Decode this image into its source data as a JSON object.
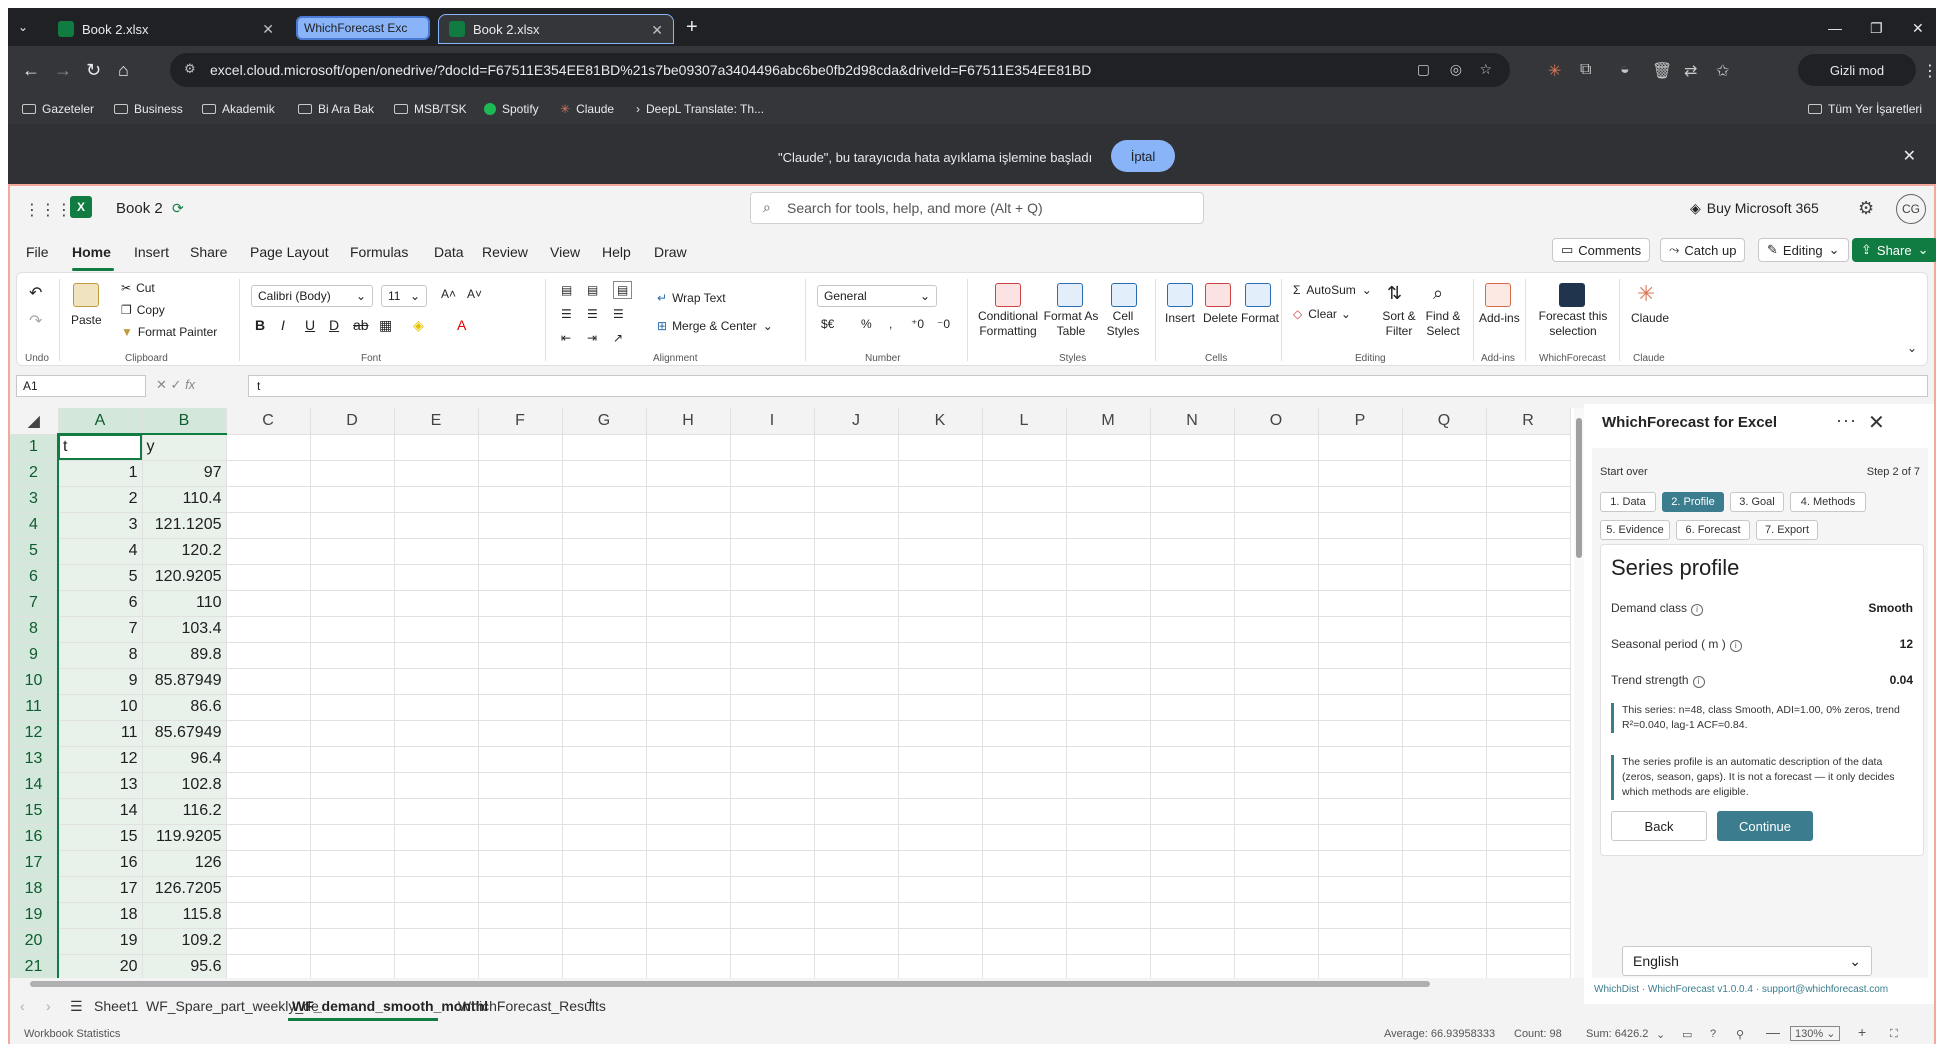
{
  "browser": {
    "tabs": [
      {
        "label": "Book 2.xlsx"
      },
      {
        "label": "WhichForecast Exc"
      },
      {
        "label": "Book 2.xlsx"
      }
    ],
    "url": "excel.cloud.microsoft/open/onedrive/?docId=F67511E354EE81BD%21s7be09307a3404496abc6be0fb2d98cda&driveId=F67511E354EE81BD",
    "incognito_label": "Gizli mod",
    "bookmarks": [
      "Gazeteler",
      "Business",
      "Akademik",
      "Bi Ara Bak",
      "MSB/TSK",
      "Spotify",
      "Claude",
      "DeepL Translate: Th..."
    ],
    "all_bookmarks": "Tüm Yer İşaretleri",
    "debug_message": "\"Claude\", bu tarayıcıda hata ayıklama işlemine başladı",
    "debug_cancel": "İptal"
  },
  "excel": {
    "book_name": "Book 2",
    "search_placeholder": "Search for tools, help, and more (Alt + Q)",
    "buy": "Buy Microsoft 365",
    "avatar": "CG",
    "menu": [
      "File",
      "Home",
      "Insert",
      "Share",
      "Page Layout",
      "Formulas",
      "Data",
      "Review",
      "View",
      "Help",
      "Draw"
    ],
    "actions": {
      "comments": "Comments",
      "catchup": "Catch up",
      "editing": "Editing",
      "share": "Share"
    },
    "ribbon": {
      "undo_group": "Undo",
      "paste": "Paste",
      "cut": "Cut",
      "copy": "Copy",
      "format_painter": "Format Painter",
      "clipboard": "Clipboard",
      "font_name": "Calibri (Body)",
      "font_size": "11",
      "font": "Font",
      "wrap_text": "Wrap Text",
      "merge_center": "Merge & Center",
      "alignment": "Alignment",
      "number_format": "General",
      "number": "Number",
      "conditional_formatting_1": "Conditional",
      "conditional_formatting_2": "Formatting",
      "format_as_table_1": "Format As",
      "format_as_table_2": "Table",
      "cell_styles_1": "Cell",
      "cell_styles_2": "Styles",
      "styles": "Styles",
      "insert": "Insert",
      "delete": "Delete",
      "format": "Format",
      "cells": "Cells",
      "autosum": "AutoSum",
      "clear": "Clear",
      "sort_filter_1": "Sort &",
      "sort_filter_2": "Filter",
      "find_select_1": "Find &",
      "find_select_2": "Select",
      "editing": "Editing",
      "addins": "Add-ins",
      "addins_group": "Add-ins",
      "forecast_1": "Forecast this",
      "forecast_2": "selection",
      "whichforecast_group": "WhichForecast",
      "claude": "Claude",
      "claude_group": "Claude"
    },
    "name_box": "A1",
    "formula": "t",
    "columns": [
      "A",
      "B",
      "C",
      "D",
      "E",
      "F",
      "G",
      "H",
      "I",
      "J",
      "K",
      "L",
      "M",
      "N",
      "O",
      "P",
      "Q",
      "R"
    ],
    "rows": [
      [
        "1",
        "t",
        "y"
      ],
      [
        "2",
        "1",
        "97"
      ],
      [
        "3",
        "2",
        "110.4"
      ],
      [
        "4",
        "3",
        "121.1205"
      ],
      [
        "5",
        "4",
        "120.2"
      ],
      [
        "6",
        "5",
        "120.9205"
      ],
      [
        "7",
        "6",
        "110"
      ],
      [
        "8",
        "7",
        "103.4"
      ],
      [
        "9",
        "8",
        "89.8"
      ],
      [
        "10",
        "9",
        "85.87949"
      ],
      [
        "11",
        "10",
        "86.6"
      ],
      [
        "12",
        "11",
        "85.67949"
      ],
      [
        "13",
        "12",
        "96.4"
      ],
      [
        "14",
        "13",
        "102.8"
      ],
      [
        "15",
        "14",
        "116.2"
      ],
      [
        "16",
        "15",
        "119.9205"
      ],
      [
        "17",
        "16",
        "126"
      ],
      [
        "18",
        "17",
        "126.7205"
      ],
      [
        "19",
        "18",
        "115.8"
      ],
      [
        "20",
        "19",
        "109.2"
      ],
      [
        "21",
        "20",
        "95.6"
      ]
    ],
    "sheet_tabs": [
      "Sheet1",
      "WF_Spare_part_weekly_de",
      "WF_demand_smooth_monthl",
      "WhichForecast_Results"
    ],
    "status": {
      "left": "Workbook Statistics",
      "average": "Average: 66.93958333",
      "count": "Count: 98",
      "sum": "Sum: 6426.2",
      "zoom": "130%"
    }
  },
  "pane": {
    "title": "WhichForecast for Excel",
    "start_over": "Start over",
    "step_of": "Step 2 of 7",
    "steps": [
      "1. Data",
      "2. Profile",
      "3. Goal",
      "4. Methods",
      "5. Evidence",
      "6. Forecast",
      "7. Export"
    ],
    "card_title": "Series profile",
    "demand_class_label": "Demand class",
    "demand_class_value": "Smooth",
    "seasonal_label": "Seasonal period ( m )",
    "seasonal_value": "12",
    "trend_label": "Trend strength",
    "trend_value": "0.04",
    "note1": "This series: n=48, class Smooth, ADI=1.00, 0% zeros, trend R²=0.040, lag-1 ACF=0.84.",
    "note2": "The series profile is an automatic description of the data (zeros, season, gaps). It is not a forecast — it only decides which methods are eligible.",
    "back": "Back",
    "continue": "Continue",
    "language": "English",
    "footer": "WhichDist · WhichForecast v1.0.0.4 · support@whichforecast.com",
    "accent": "#3b7d8e"
  }
}
